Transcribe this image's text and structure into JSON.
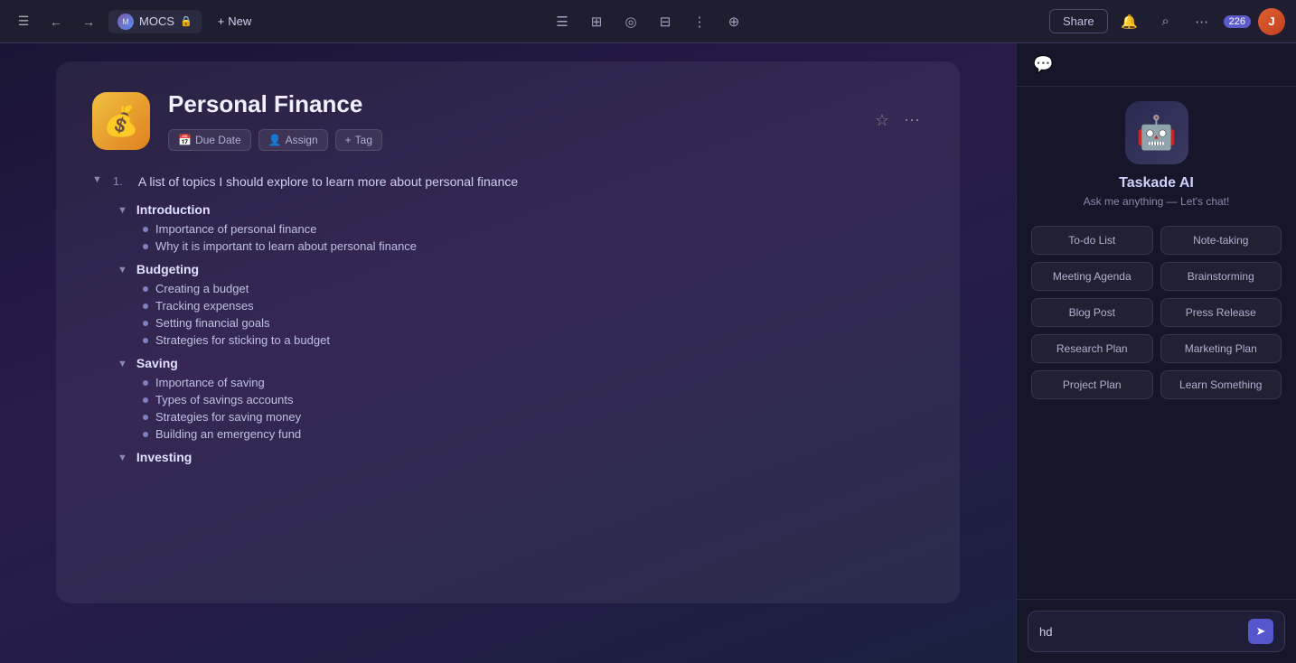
{
  "toolbar": {
    "project_name": "MOCS",
    "new_label": "New",
    "share_label": "Share",
    "badge_count": "226"
  },
  "document": {
    "emoji": "💰",
    "title": "Personal Finance",
    "meta": {
      "due_date": "Due Date",
      "assign": "Assign",
      "tag": "Tag"
    },
    "outline_item": "A list of topics I should explore to learn more about personal finance",
    "sections": [
      {
        "title": "Introduction",
        "bullets": [
          "Importance of personal finance",
          "Why it is important to learn about personal finance"
        ]
      },
      {
        "title": "Budgeting",
        "bullets": [
          "Creating a budget",
          "Tracking expenses",
          "Setting financial goals",
          "Strategies for sticking to a budget"
        ]
      },
      {
        "title": "Saving",
        "bullets": [
          "Importance of saving",
          "Types of savings accounts",
          "Strategies for saving money",
          "Building an emergency fund"
        ]
      },
      {
        "title": "Investing",
        "bullets": []
      }
    ]
  },
  "ai_panel": {
    "title": "Taskade AI",
    "subtitle": "Ask me anything — Let's chat!",
    "chips": [
      "To-do List",
      "Note-taking",
      "Meeting Agenda",
      "Brainstorming",
      "Blog Post",
      "Press Release",
      "Research Plan",
      "Marketing Plan",
      "Project Plan",
      "Learn Something"
    ],
    "chat_placeholder": "hd",
    "send_icon": "➤"
  }
}
